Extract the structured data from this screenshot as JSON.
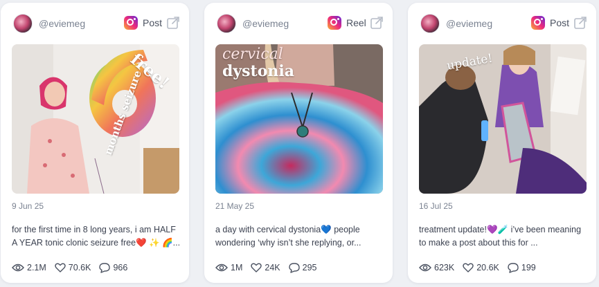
{
  "cards": [
    {
      "handle": "@eviemeg",
      "type": "Post",
      "overlay_words": [
        "free!",
        "months seizure"
      ],
      "date": "9 Jun 25",
      "caption": "for the first time in 8 long years, i am HALF A YEAR tonic clonic seizure free❤️ ✨ 🌈...",
      "views": "2.1M",
      "likes": "70.6K",
      "comments": "966"
    },
    {
      "handle": "@eviemeg",
      "type": "Reel",
      "overlay_words": [
        "cervical",
        "dystonia"
      ],
      "date": "21 May 25",
      "caption": "a day with cervical dystonia💙 people wondering ‘why isn’t she replying, or...",
      "views": "1M",
      "likes": "24K",
      "comments": "295"
    },
    {
      "handle": "@eviemeg",
      "type": "Post",
      "overlay_words": [
        "update!"
      ],
      "date": "16 Jul 25",
      "caption": "treatment update!💜🧪 i’ve been meaning to make a post about this for ...",
      "views": "623K",
      "likes": "20.6K",
      "comments": "199"
    }
  ],
  "colors": {
    "instagram_gradient": [
      "#f9b233",
      "#ee2a7b",
      "#6228d7"
    ],
    "muted_text": "#7a8291",
    "body_text": "#3b4150"
  },
  "icons": {
    "platform": "instagram-icon",
    "open": "external-link-icon",
    "views": "eye-icon",
    "likes": "heart-icon",
    "comments": "comment-icon"
  }
}
